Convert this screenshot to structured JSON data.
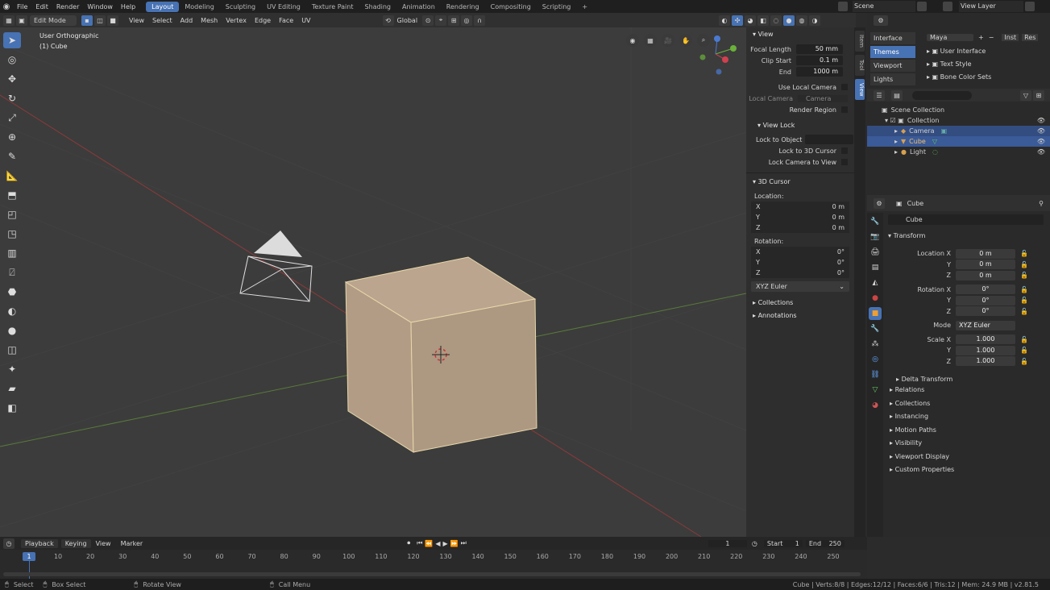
{
  "topbar": {
    "menus": [
      "File",
      "Edit",
      "Render",
      "Window",
      "Help"
    ],
    "workspaces": [
      "Layout",
      "Modeling",
      "Sculpting",
      "UV Editing",
      "Texture Paint",
      "Shading",
      "Animation",
      "Rendering",
      "Compositing",
      "Scripting"
    ],
    "add_tab": "+",
    "scene": "Scene",
    "view_layer": "View Layer"
  },
  "header": {
    "mode": "Edit Mode",
    "menus": [
      "View",
      "Select",
      "Add",
      "Mesh",
      "Vertex",
      "Edge",
      "Face",
      "UV"
    ],
    "orientation": "Global"
  },
  "viewport": {
    "view_name": "User Orthographic",
    "object_name": "(1) Cube",
    "axes": {
      "x": "X",
      "y": "Y",
      "z": "Z"
    }
  },
  "npanel": {
    "view_title": "View",
    "focal_length_label": "Focal Length",
    "focal_length": "50 mm",
    "clip_start_label": "Clip Start",
    "clip_start": "0.1 m",
    "end_label": "End",
    "end": "1000 m",
    "use_local_camera": "Use Local Camera",
    "local_camera_label": "Local Camera",
    "local_camera": "Camera",
    "render_region": "Render Region",
    "view_lock": "View Lock",
    "lock_to_object": "Lock to Object",
    "lock_to_cursor": "Lock to 3D Cursor",
    "lock_camera": "Lock Camera to View",
    "cursor_title": "3D Cursor",
    "location_label": "Location:",
    "loc": [
      {
        "a": "X",
        "v": "0 m"
      },
      {
        "a": "Y",
        "v": "0 m"
      },
      {
        "a": "Z",
        "v": "0 m"
      }
    ],
    "rotation_label": "Rotation:",
    "rot": [
      {
        "a": "X",
        "v": "0°"
      },
      {
        "a": "Y",
        "v": "0°"
      },
      {
        "a": "Z",
        "v": "0°"
      }
    ],
    "rot_mode": "XYZ Euler",
    "collections": "Collections",
    "annotations": "Annotations",
    "tabs": [
      "Item",
      "Tool",
      "View"
    ]
  },
  "prefs": {
    "tabs": [
      "Interface",
      "Themes",
      "Viewport",
      "Lights"
    ],
    "preset": "Maya",
    "install": "Inst",
    "reset": "Res",
    "items": [
      "User Interface",
      "Text Style",
      "Bone Color Sets"
    ]
  },
  "outliner": {
    "scene_collection": "Scene Collection",
    "collection": "Collection",
    "items": [
      "Camera",
      "Cube",
      "Light"
    ]
  },
  "props": {
    "object": "Cube",
    "object_name": "Cube",
    "transform": "Transform",
    "location_x": "Location X",
    "loc": [
      "0 m",
      "0 m",
      "0 m"
    ],
    "rotation_x": "Rotation X",
    "rot": [
      "0°",
      "0°",
      "0°"
    ],
    "y": "Y",
    "z": "Z",
    "mode_label": "Mode",
    "mode": "XYZ Euler",
    "scale_x": "Scale X",
    "scale": [
      "1.000",
      "1.000",
      "1.000"
    ],
    "delta": "Delta Transform",
    "sections": [
      "Relations",
      "Collections",
      "Instancing",
      "Motion Paths",
      "Visibility",
      "Viewport Display",
      "Custom Properties"
    ]
  },
  "timeline": {
    "menus": [
      "Playback",
      "Keying",
      "View",
      "Marker"
    ],
    "current_frame": "1",
    "start_label": "Start",
    "start": "1",
    "end_label": "End",
    "end": "250",
    "ticks": [
      "1",
      "10",
      "20",
      "30",
      "40",
      "50",
      "60",
      "70",
      "80",
      "90",
      "100",
      "110",
      "120",
      "130",
      "140",
      "150",
      "160",
      "170",
      "180",
      "190",
      "200",
      "210",
      "220",
      "230",
      "240",
      "250"
    ]
  },
  "status": {
    "select": "Select",
    "box_select": "Box Select",
    "rotate_view": "Rotate View",
    "call_menu": "Call Menu",
    "stats": "Cube | Verts:8/8 | Edges:12/12 | Faces:6/6 | Tris:12 | Mem: 24.9 MB | v2.81.5"
  },
  "colors": {
    "accent": "#4772b3",
    "selection": "#334d80",
    "cube_face": "#b39e88"
  }
}
